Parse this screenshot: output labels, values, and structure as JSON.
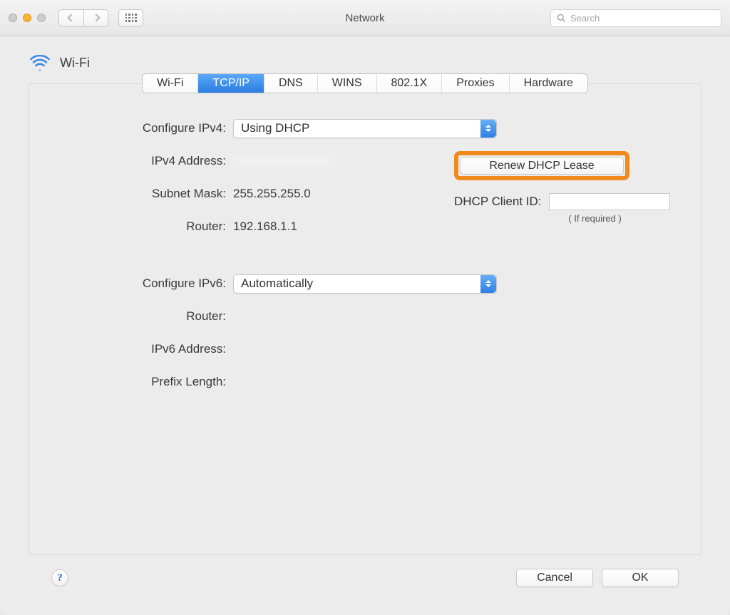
{
  "toolbar": {
    "title": "Network",
    "search_placeholder": "Search"
  },
  "header": {
    "title": "Wi-Fi"
  },
  "tabs": [
    "Wi-Fi",
    "TCP/IP",
    "DNS",
    "WINS",
    "802.1X",
    "Proxies",
    "Hardware"
  ],
  "active_tab_index": 1,
  "form": {
    "configure_ipv4_label": "Configure IPv4:",
    "configure_ipv4_value": "Using DHCP",
    "ipv4_address_label": "IPv4 Address:",
    "ipv4_address_value": "",
    "subnet_mask_label": "Subnet Mask:",
    "subnet_mask_value": "255.255.255.0",
    "router_label": "Router:",
    "router_value": "192.168.1.1",
    "configure_ipv6_label": "Configure IPv6:",
    "configure_ipv6_value": "Automatically",
    "ipv6_router_label": "Router:",
    "ipv6_router_value": "",
    "ipv6_address_label": "IPv6 Address:",
    "ipv6_address_value": "",
    "prefix_length_label": "Prefix Length:",
    "prefix_length_value": ""
  },
  "right": {
    "renew_button": "Renew DHCP Lease",
    "dhcp_client_id_label": "DHCP Client ID:",
    "dhcp_client_id_value": "",
    "if_required": "( If required )"
  },
  "footer": {
    "cancel": "Cancel",
    "ok": "OK"
  }
}
